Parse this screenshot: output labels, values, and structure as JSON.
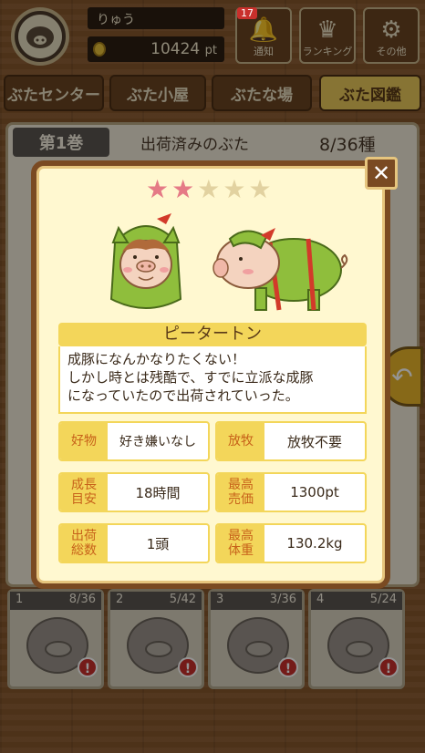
{
  "header": {
    "username": "りゅう",
    "points": "10424",
    "points_unit": "pt",
    "notification_count": "17",
    "buttons": [
      {
        "label": "通知",
        "icon": "bell-icon"
      },
      {
        "label": "ランキング",
        "icon": "crown-icon"
      },
      {
        "label": "その他",
        "icon": "gear-icon"
      }
    ]
  },
  "tabs": [
    {
      "label": "ぶたセンター"
    },
    {
      "label": "ぶた小屋"
    },
    {
      "label": "ぶたな場"
    },
    {
      "label": "ぶた図鑑"
    }
  ],
  "book": {
    "volume": "第1巻",
    "shipped_label": "出荷済みのぶた",
    "shipped_count": "8/36",
    "shipped_unit": "種"
  },
  "bottom_cards": [
    {
      "num": "1",
      "count": "8/36"
    },
    {
      "num": "2",
      "count": "5/42"
    },
    {
      "num": "3",
      "count": "3/36"
    },
    {
      "num": "4",
      "count": "5/24"
    }
  ],
  "modal": {
    "rating": 2,
    "rating_max": 5,
    "pig_name": "ピータートン",
    "description": [
      "成豚になんかなりたくない！",
      "しかし時とは残酷で、すでに立派な成豚",
      "になっていたので出荷されていった。"
    ],
    "stats": [
      {
        "key": "好物",
        "value": "好き嫌いなし"
      },
      {
        "key": "放牧",
        "value": "放牧不要"
      },
      {
        "key": "成長目安",
        "value": "18時間"
      },
      {
        "key": "最高売価",
        "value": "1300pt"
      },
      {
        "key": "出荷総数",
        "value": "1頭"
      },
      {
        "key": "最高体重",
        "value": "130.2kg"
      }
    ]
  },
  "colors": {
    "accent": "#f3d65a",
    "star_on": "#e57a86",
    "modal_border": "#7a4a22"
  }
}
